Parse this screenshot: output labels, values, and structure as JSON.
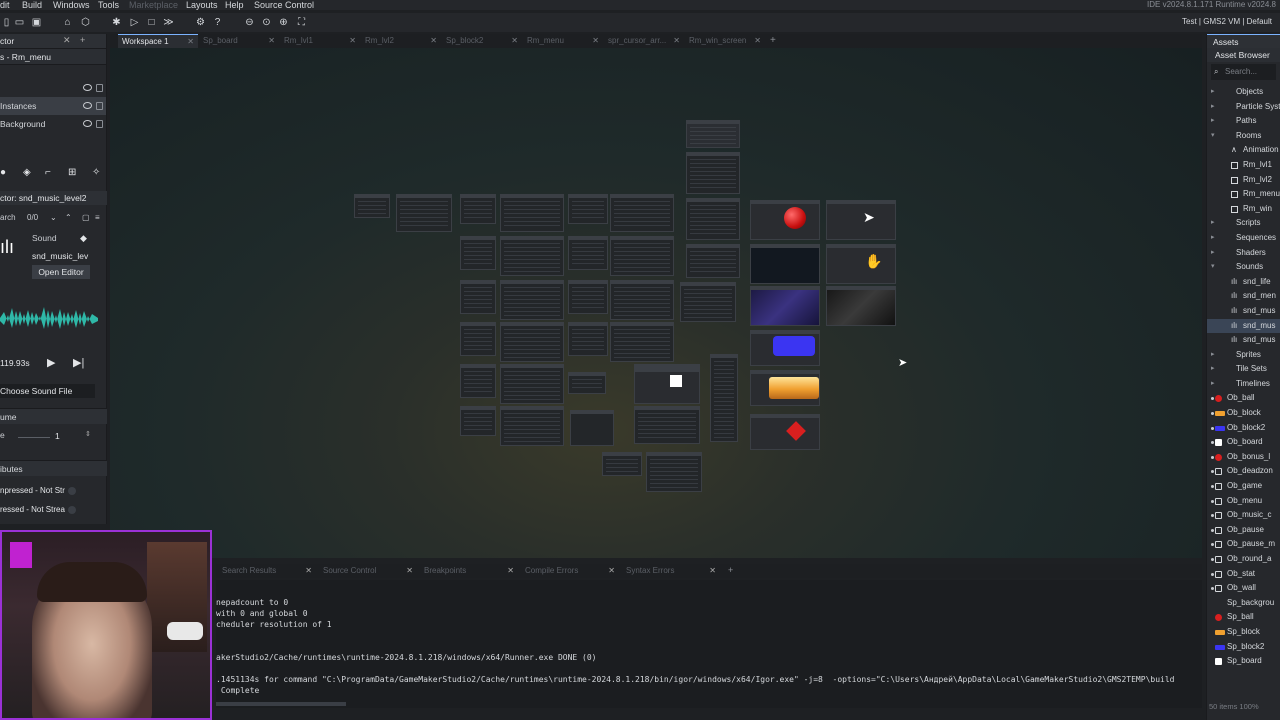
{
  "menubar": {
    "items": [
      "dit",
      "Build",
      "Windows",
      "Tools",
      "Marketplace",
      "Layouts",
      "Help",
      "Source Control"
    ],
    "right_text": "IDE v2024.8.1.171  Runtime v2024.8"
  },
  "toolbar": {
    "target": "Test | GMS2 VM | Default"
  },
  "left_panel": {
    "tab_title": "ctor",
    "room_title": "s - Rm_menu",
    "layers": [
      {
        "label": "Instances",
        "selected": true
      },
      {
        "label": "Background",
        "selected": false
      }
    ],
    "inspector_title": "ctor: snd_music_level2",
    "search_label": "arch",
    "search_count": "0/0",
    "sound_label": "Sound",
    "sound_name": "snd_music_lev",
    "open_editor": "Open Editor",
    "duration": "119.93s",
    "choose_file": "Choose Sound File",
    "volume_head": "ume",
    "volume_label": "e",
    "volume_value": "1",
    "attributes_head": "ibutes",
    "attr_1": "npressed - Not Str",
    "attr_2": "ressed - Not Strea"
  },
  "workspace_tabs": [
    {
      "label": "Workspace 1",
      "active": true
    },
    {
      "label": "Sp_board",
      "active": false
    },
    {
      "label": "Rm_lvl1",
      "active": false
    },
    {
      "label": "Rm_lvl2",
      "active": false
    },
    {
      "label": "Sp_block2",
      "active": false
    },
    {
      "label": "Rm_menu",
      "active": false
    },
    {
      "label": "spr_cursor_arr...",
      "active": false
    },
    {
      "label": "Rm_win_screen",
      "active": false
    }
  ],
  "right_panel": {
    "title": "Assets",
    "subtitle": "Asset Browser",
    "search_placeholder": "Search...",
    "tree": [
      {
        "label": "Objects",
        "indent": 0,
        "kind": "folder"
      },
      {
        "label": "Particle Syste",
        "indent": 0,
        "kind": "folder"
      },
      {
        "label": "Paths",
        "indent": 0,
        "kind": "folder"
      },
      {
        "label": "Rooms",
        "indent": 0,
        "kind": "open"
      },
      {
        "label": "Animation",
        "indent": 1,
        "kind": "anim"
      },
      {
        "label": "Rm_lvl1",
        "indent": 1,
        "kind": "room"
      },
      {
        "label": "Rm_lvl2",
        "indent": 1,
        "kind": "room"
      },
      {
        "label": "Rm_menu",
        "indent": 1,
        "kind": "room-home"
      },
      {
        "label": "Rm_win",
        "indent": 1,
        "kind": "room"
      },
      {
        "label": "Scripts",
        "indent": 0,
        "kind": "folder"
      },
      {
        "label": "Sequences",
        "indent": 0,
        "kind": "folder"
      },
      {
        "label": "Shaders",
        "indent": 0,
        "kind": "folder"
      },
      {
        "label": "Sounds",
        "indent": 0,
        "kind": "open"
      },
      {
        "label": "snd_life",
        "indent": 1,
        "kind": "sound"
      },
      {
        "label": "snd_men",
        "indent": 1,
        "kind": "sound"
      },
      {
        "label": "snd_mus",
        "indent": 1,
        "kind": "sound"
      },
      {
        "label": "snd_mus",
        "indent": 1,
        "kind": "sound-sel"
      },
      {
        "label": "snd_mus",
        "indent": 1,
        "kind": "sound"
      },
      {
        "label": "Sprites",
        "indent": 0,
        "kind": "folder"
      },
      {
        "label": "Tile Sets",
        "indent": 0,
        "kind": "folder"
      },
      {
        "label": "Timelines",
        "indent": 0,
        "kind": "folder"
      },
      {
        "label": "Ob_ball",
        "indent": 0,
        "kind": "obj-red"
      },
      {
        "label": "Ob_block",
        "indent": 0,
        "kind": "obj-orange"
      },
      {
        "label": "Ob_block2",
        "indent": 0,
        "kind": "obj-blue"
      },
      {
        "label": "Ob_board",
        "indent": 0,
        "kind": "obj-white"
      },
      {
        "label": "Ob_bonus_l",
        "indent": 0,
        "kind": "obj-red-small"
      },
      {
        "label": "Ob_deadzon",
        "indent": 0,
        "kind": "obj-empty"
      },
      {
        "label": "Ob_game",
        "indent": 0,
        "kind": "obj-empty"
      },
      {
        "label": "Ob_menu",
        "indent": 0,
        "kind": "obj-empty"
      },
      {
        "label": "Ob_music_c",
        "indent": 0,
        "kind": "obj-empty"
      },
      {
        "label": "Ob_pause",
        "indent": 0,
        "kind": "obj-empty"
      },
      {
        "label": "Ob_pause_m",
        "indent": 0,
        "kind": "obj-empty"
      },
      {
        "label": "Ob_round_a",
        "indent": 0,
        "kind": "obj-empty"
      },
      {
        "label": "Ob_stat",
        "indent": 0,
        "kind": "obj-empty"
      },
      {
        "label": "Ob_wall",
        "indent": 0,
        "kind": "obj-empty"
      },
      {
        "label": "Sp_backgrou",
        "indent": 0,
        "kind": "spr-none"
      },
      {
        "label": "Sp_ball",
        "indent": 0,
        "kind": "spr-red"
      },
      {
        "label": "Sp_block",
        "indent": 0,
        "kind": "spr-orange"
      },
      {
        "label": "Sp_block2",
        "indent": 0,
        "kind": "spr-blue"
      },
      {
        "label": "Sp_board",
        "indent": 0,
        "kind": "spr-white"
      }
    ],
    "status": "50 items  100%"
  },
  "output_tabs": [
    "Search Results",
    "Source Control",
    "Breakpoints",
    "Compile Errors",
    "Syntax Errors"
  ],
  "output_lines": [
    "nepadcount to 0",
    "with 0 and global 0",
    "cheduler resolution of 1",
    "",
    "",
    "akerStudio2/Cache/runtimes\\runtime-2024.8.1.218/windows/x64/Runner.exe DONE (0)",
    "",
    ".1451134s for command \"C:\\ProgramData/GameMakerStudio2/Cache/runtimes\\runtime-2024.8.1.218/bin/igor/windows/x64/Igor.exe\" -j=8  -options=\"C:\\Users\\Андрей\\AppData\\Local\\GameMakerStudio2\\GMS2TEMP\\build",
    " Complete"
  ],
  "colors": {
    "accent": "#7bb3ff",
    "webcam_border": "#9b31d6",
    "waveform": "#2fb8a8",
    "red_ball": "#d81f1f",
    "blue_block": "#3b35f2",
    "orange_block": "#f0a030"
  }
}
